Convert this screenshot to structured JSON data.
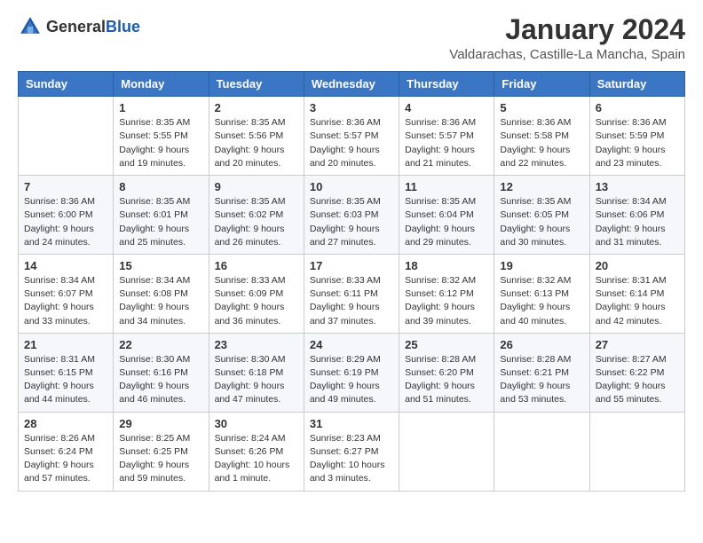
{
  "logo": {
    "general": "General",
    "blue": "Blue"
  },
  "title": "January 2024",
  "subtitle": "Valdarachas, Castille-La Mancha, Spain",
  "headers": [
    "Sunday",
    "Monday",
    "Tuesday",
    "Wednesday",
    "Thursday",
    "Friday",
    "Saturday"
  ],
  "weeks": [
    [
      {
        "day": "",
        "sunrise": "",
        "sunset": "",
        "daylight": ""
      },
      {
        "day": "1",
        "sunrise": "Sunrise: 8:35 AM",
        "sunset": "Sunset: 5:55 PM",
        "daylight": "Daylight: 9 hours and 19 minutes."
      },
      {
        "day": "2",
        "sunrise": "Sunrise: 8:35 AM",
        "sunset": "Sunset: 5:56 PM",
        "daylight": "Daylight: 9 hours and 20 minutes."
      },
      {
        "day": "3",
        "sunrise": "Sunrise: 8:36 AM",
        "sunset": "Sunset: 5:57 PM",
        "daylight": "Daylight: 9 hours and 20 minutes."
      },
      {
        "day": "4",
        "sunrise": "Sunrise: 8:36 AM",
        "sunset": "Sunset: 5:57 PM",
        "daylight": "Daylight: 9 hours and 21 minutes."
      },
      {
        "day": "5",
        "sunrise": "Sunrise: 8:36 AM",
        "sunset": "Sunset: 5:58 PM",
        "daylight": "Daylight: 9 hours and 22 minutes."
      },
      {
        "day": "6",
        "sunrise": "Sunrise: 8:36 AM",
        "sunset": "Sunset: 5:59 PM",
        "daylight": "Daylight: 9 hours and 23 minutes."
      }
    ],
    [
      {
        "day": "7",
        "sunrise": "Sunrise: 8:36 AM",
        "sunset": "Sunset: 6:00 PM",
        "daylight": "Daylight: 9 hours and 24 minutes."
      },
      {
        "day": "8",
        "sunrise": "Sunrise: 8:35 AM",
        "sunset": "Sunset: 6:01 PM",
        "daylight": "Daylight: 9 hours and 25 minutes."
      },
      {
        "day": "9",
        "sunrise": "Sunrise: 8:35 AM",
        "sunset": "Sunset: 6:02 PM",
        "daylight": "Daylight: 9 hours and 26 minutes."
      },
      {
        "day": "10",
        "sunrise": "Sunrise: 8:35 AM",
        "sunset": "Sunset: 6:03 PM",
        "daylight": "Daylight: 9 hours and 27 minutes."
      },
      {
        "day": "11",
        "sunrise": "Sunrise: 8:35 AM",
        "sunset": "Sunset: 6:04 PM",
        "daylight": "Daylight: 9 hours and 29 minutes."
      },
      {
        "day": "12",
        "sunrise": "Sunrise: 8:35 AM",
        "sunset": "Sunset: 6:05 PM",
        "daylight": "Daylight: 9 hours and 30 minutes."
      },
      {
        "day": "13",
        "sunrise": "Sunrise: 8:34 AM",
        "sunset": "Sunset: 6:06 PM",
        "daylight": "Daylight: 9 hours and 31 minutes."
      }
    ],
    [
      {
        "day": "14",
        "sunrise": "Sunrise: 8:34 AM",
        "sunset": "Sunset: 6:07 PM",
        "daylight": "Daylight: 9 hours and 33 minutes."
      },
      {
        "day": "15",
        "sunrise": "Sunrise: 8:34 AM",
        "sunset": "Sunset: 6:08 PM",
        "daylight": "Daylight: 9 hours and 34 minutes."
      },
      {
        "day": "16",
        "sunrise": "Sunrise: 8:33 AM",
        "sunset": "Sunset: 6:09 PM",
        "daylight": "Daylight: 9 hours and 36 minutes."
      },
      {
        "day": "17",
        "sunrise": "Sunrise: 8:33 AM",
        "sunset": "Sunset: 6:11 PM",
        "daylight": "Daylight: 9 hours and 37 minutes."
      },
      {
        "day": "18",
        "sunrise": "Sunrise: 8:32 AM",
        "sunset": "Sunset: 6:12 PM",
        "daylight": "Daylight: 9 hours and 39 minutes."
      },
      {
        "day": "19",
        "sunrise": "Sunrise: 8:32 AM",
        "sunset": "Sunset: 6:13 PM",
        "daylight": "Daylight: 9 hours and 40 minutes."
      },
      {
        "day": "20",
        "sunrise": "Sunrise: 8:31 AM",
        "sunset": "Sunset: 6:14 PM",
        "daylight": "Daylight: 9 hours and 42 minutes."
      }
    ],
    [
      {
        "day": "21",
        "sunrise": "Sunrise: 8:31 AM",
        "sunset": "Sunset: 6:15 PM",
        "daylight": "Daylight: 9 hours and 44 minutes."
      },
      {
        "day": "22",
        "sunrise": "Sunrise: 8:30 AM",
        "sunset": "Sunset: 6:16 PM",
        "daylight": "Daylight: 9 hours and 46 minutes."
      },
      {
        "day": "23",
        "sunrise": "Sunrise: 8:30 AM",
        "sunset": "Sunset: 6:18 PM",
        "daylight": "Daylight: 9 hours and 47 minutes."
      },
      {
        "day": "24",
        "sunrise": "Sunrise: 8:29 AM",
        "sunset": "Sunset: 6:19 PM",
        "daylight": "Daylight: 9 hours and 49 minutes."
      },
      {
        "day": "25",
        "sunrise": "Sunrise: 8:28 AM",
        "sunset": "Sunset: 6:20 PM",
        "daylight": "Daylight: 9 hours and 51 minutes."
      },
      {
        "day": "26",
        "sunrise": "Sunrise: 8:28 AM",
        "sunset": "Sunset: 6:21 PM",
        "daylight": "Daylight: 9 hours and 53 minutes."
      },
      {
        "day": "27",
        "sunrise": "Sunrise: 8:27 AM",
        "sunset": "Sunset: 6:22 PM",
        "daylight": "Daylight: 9 hours and 55 minutes."
      }
    ],
    [
      {
        "day": "28",
        "sunrise": "Sunrise: 8:26 AM",
        "sunset": "Sunset: 6:24 PM",
        "daylight": "Daylight: 9 hours and 57 minutes."
      },
      {
        "day": "29",
        "sunrise": "Sunrise: 8:25 AM",
        "sunset": "Sunset: 6:25 PM",
        "daylight": "Daylight: 9 hours and 59 minutes."
      },
      {
        "day": "30",
        "sunrise": "Sunrise: 8:24 AM",
        "sunset": "Sunset: 6:26 PM",
        "daylight": "Daylight: 10 hours and 1 minute."
      },
      {
        "day": "31",
        "sunrise": "Sunrise: 8:23 AM",
        "sunset": "Sunset: 6:27 PM",
        "daylight": "Daylight: 10 hours and 3 minutes."
      },
      {
        "day": "",
        "sunrise": "",
        "sunset": "",
        "daylight": ""
      },
      {
        "day": "",
        "sunrise": "",
        "sunset": "",
        "daylight": ""
      },
      {
        "day": "",
        "sunrise": "",
        "sunset": "",
        "daylight": ""
      }
    ]
  ]
}
